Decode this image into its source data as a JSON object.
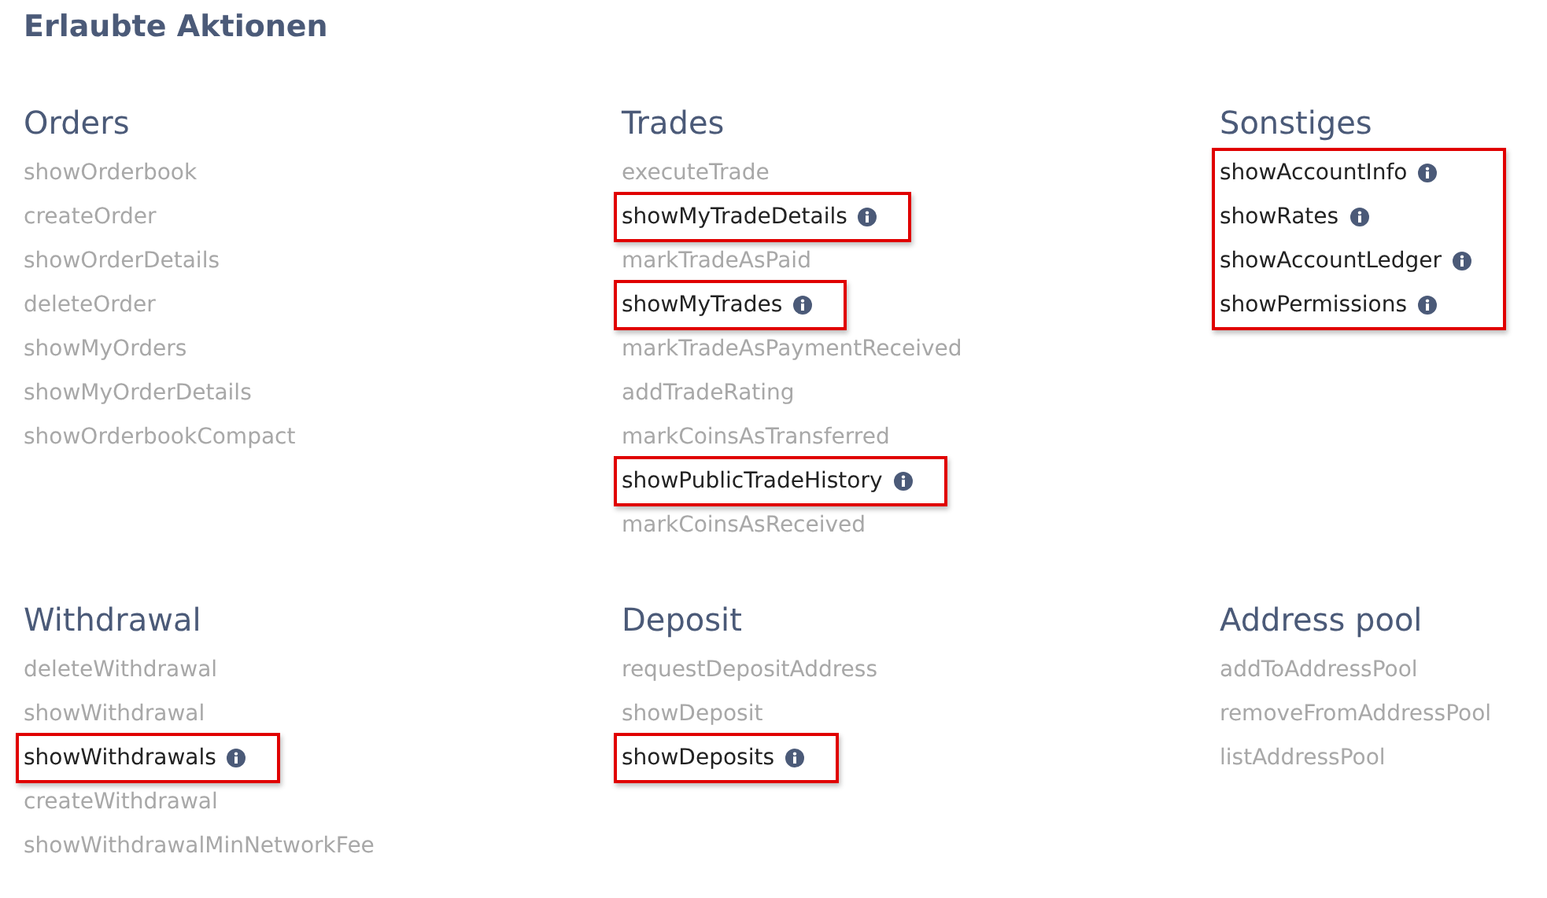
{
  "title": "Erlaubte Aktionen",
  "sections": [
    {
      "heading": "Orders",
      "items": [
        {
          "name": "showOrderbook",
          "allowed": false
        },
        {
          "name": "createOrder",
          "allowed": false
        },
        {
          "name": "showOrderDetails",
          "allowed": false
        },
        {
          "name": "deleteOrder",
          "allowed": false
        },
        {
          "name": "showMyOrders",
          "allowed": false
        },
        {
          "name": "showMyOrderDetails",
          "allowed": false
        },
        {
          "name": "showOrderbookCompact",
          "allowed": false
        }
      ]
    },
    {
      "heading": "Trades",
      "items": [
        {
          "name": "executeTrade",
          "allowed": false
        },
        {
          "name": "showMyTradeDetails",
          "allowed": true
        },
        {
          "name": "markTradeAsPaid",
          "allowed": false
        },
        {
          "name": "showMyTrades",
          "allowed": true
        },
        {
          "name": "markTradeAsPaymentReceived",
          "allowed": false
        },
        {
          "name": "addTradeRating",
          "allowed": false
        },
        {
          "name": "markCoinsAsTransferred",
          "allowed": false
        },
        {
          "name": "showPublicTradeHistory",
          "allowed": true
        },
        {
          "name": "markCoinsAsReceived",
          "allowed": false
        }
      ]
    },
    {
      "heading": "Sonstiges",
      "items": [
        {
          "name": "showAccountInfo",
          "allowed": true
        },
        {
          "name": "showRates",
          "allowed": true
        },
        {
          "name": "showAccountLedger",
          "allowed": true
        },
        {
          "name": "showPermissions",
          "allowed": true
        }
      ]
    },
    {
      "heading": "Withdrawal",
      "items": [
        {
          "name": "deleteWithdrawal",
          "allowed": false
        },
        {
          "name": "showWithdrawal",
          "allowed": false
        },
        {
          "name": "showWithdrawals",
          "allowed": true
        },
        {
          "name": "createWithdrawal",
          "allowed": false
        },
        {
          "name": "showWithdrawalMinNetworkFee",
          "allowed": false
        }
      ]
    },
    {
      "heading": "Deposit",
      "items": [
        {
          "name": "requestDepositAddress",
          "allowed": false
        },
        {
          "name": "showDeposit",
          "allowed": false
        },
        {
          "name": "showDeposits",
          "allowed": true
        }
      ]
    },
    {
      "heading": "Address pool",
      "items": [
        {
          "name": "addToAddressPool",
          "allowed": false
        },
        {
          "name": "removeFromAddressPool",
          "allowed": false
        },
        {
          "name": "listAddressPool",
          "allowed": false
        }
      ]
    }
  ]
}
